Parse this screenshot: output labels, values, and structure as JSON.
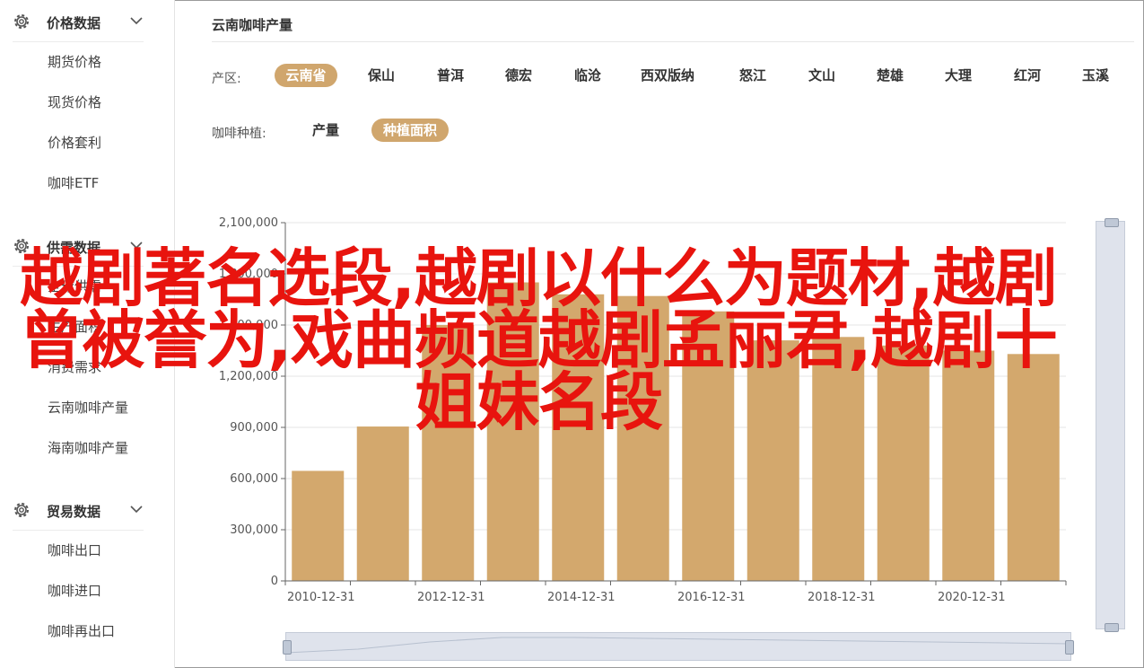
{
  "sidebar": {
    "sections": [
      {
        "title": "价格数据",
        "items": [
          "期货价格",
          "现货价格",
          "价格套利",
          "咖啡ETF"
        ]
      },
      {
        "title": "供需数据",
        "items": [
          "全球供需",
          "生产面积",
          "消费需求",
          "云南咖啡产量",
          "海南咖啡产量"
        ]
      },
      {
        "title": "贸易数据",
        "items": [
          "咖啡出口",
          "咖啡进口",
          "咖啡再出口"
        ]
      }
    ]
  },
  "main": {
    "title": "云南咖啡产量",
    "filters": {
      "region_label": "产区:",
      "regions": [
        "云南省",
        "保山",
        "普洱",
        "德宏",
        "临沧",
        "西双版纳",
        "怒江",
        "文山",
        "楚雄",
        "大理",
        "红河",
        "玉溪"
      ],
      "region_selected": "云南省",
      "type_label": "咖啡种植:",
      "types": [
        "产量",
        "种植面积"
      ],
      "type_selected": "种植面积"
    }
  },
  "chart_data": {
    "type": "bar",
    "x": [
      "2010-12-31",
      "2011-12-31",
      "2012-12-31",
      "2013-12-31",
      "2014-12-31",
      "2015-12-31",
      "2016-12-31",
      "2017-12-31",
      "2018-12-31",
      "2019-12-31",
      "2020-12-31",
      "2021-12-31"
    ],
    "x_tick_labels": [
      "2010-12-31",
      "2012-12-31",
      "2014-12-31",
      "2016-12-31",
      "2018-12-31",
      "2020-12-31"
    ],
    "values": [
      645000,
      905000,
      1500000,
      1750000,
      1680000,
      1670000,
      1580000,
      1410000,
      1430000,
      1380000,
      1350000,
      1330000
    ],
    "y_ticks": [
      "0",
      "300,000",
      "600,000",
      "900,000",
      "1,200,000",
      "1,500,000",
      "1,800,000",
      "2,100,000"
    ],
    "ylim": [
      0,
      2100000
    ],
    "xlabel": "",
    "ylabel": "",
    "grid": true,
    "color": "#d3a86d"
  },
  "overlay_text": "越剧著名选段,越剧以什么为题材,越剧曾被誉为,戏曲频道越剧孟丽君,越剧十姐妹名段",
  "colors": {
    "accent": "#d0a66d",
    "overlay": "#e8140e",
    "bar": "#d3a86d"
  }
}
